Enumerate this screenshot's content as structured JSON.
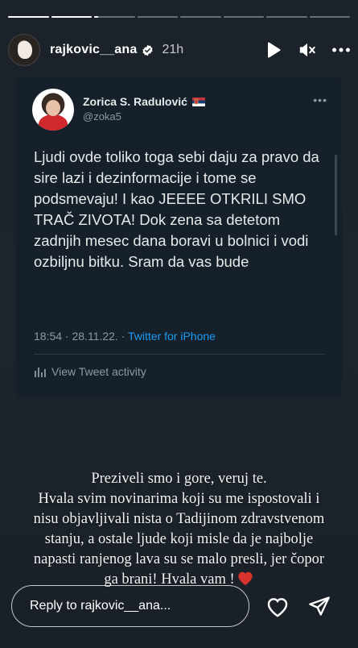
{
  "progress": [
    {
      "fill": 1.0
    },
    {
      "fill": 1.0
    },
    {
      "fill": 0.1
    },
    {
      "fill": 0
    },
    {
      "fill": 0
    },
    {
      "fill": 0
    },
    {
      "fill": 0
    },
    {
      "fill": 0
    }
  ],
  "header": {
    "username": "rajkovic__ana",
    "time": "21h",
    "icons": [
      "play-icon",
      "mute-icon",
      "more-icon"
    ]
  },
  "tweet": {
    "name": "Zorica S. Radulović",
    "handle": "@zoka5",
    "body": "Ljudi ovde toliko toga sebi daju za pravo da sire lazi i dezinformacije i tome se podsmevaju! I kao JEEEE OTKRILI SMO TRAČ ZIVOTA! Dok zena sa detetom zadnjih mesec dana boravi u bolnici i vodi ozbiljnu bitku. Sram da vas bude",
    "timestamp": "18:54 · 28.11.22. · ",
    "source": "Twitter for iPhone",
    "activity": "View Tweet activity"
  },
  "caption": {
    "lines": [
      "Preziveli smo i gore, veruj te.",
      "Hvala svim novinarima koji su me ispostovali i",
      "nisu objavljivali nista o Tadijinom zdravstvenom",
      "stanju, a ostale ljude koji misle da je najbolje",
      "napasti ranjenog lava su se malo presli, jer čopor",
      "ga brani! Hvala vam !"
    ],
    "emoji": "heart-emoji"
  },
  "footer": {
    "reply_placeholder": "Reply to rajkovic__ana..."
  },
  "colors": {
    "background": "#1c232b",
    "tweet_bg": "#15202b",
    "link": "#1d9bf0",
    "muted": "#8b98a5",
    "heart": "#d9332e"
  }
}
